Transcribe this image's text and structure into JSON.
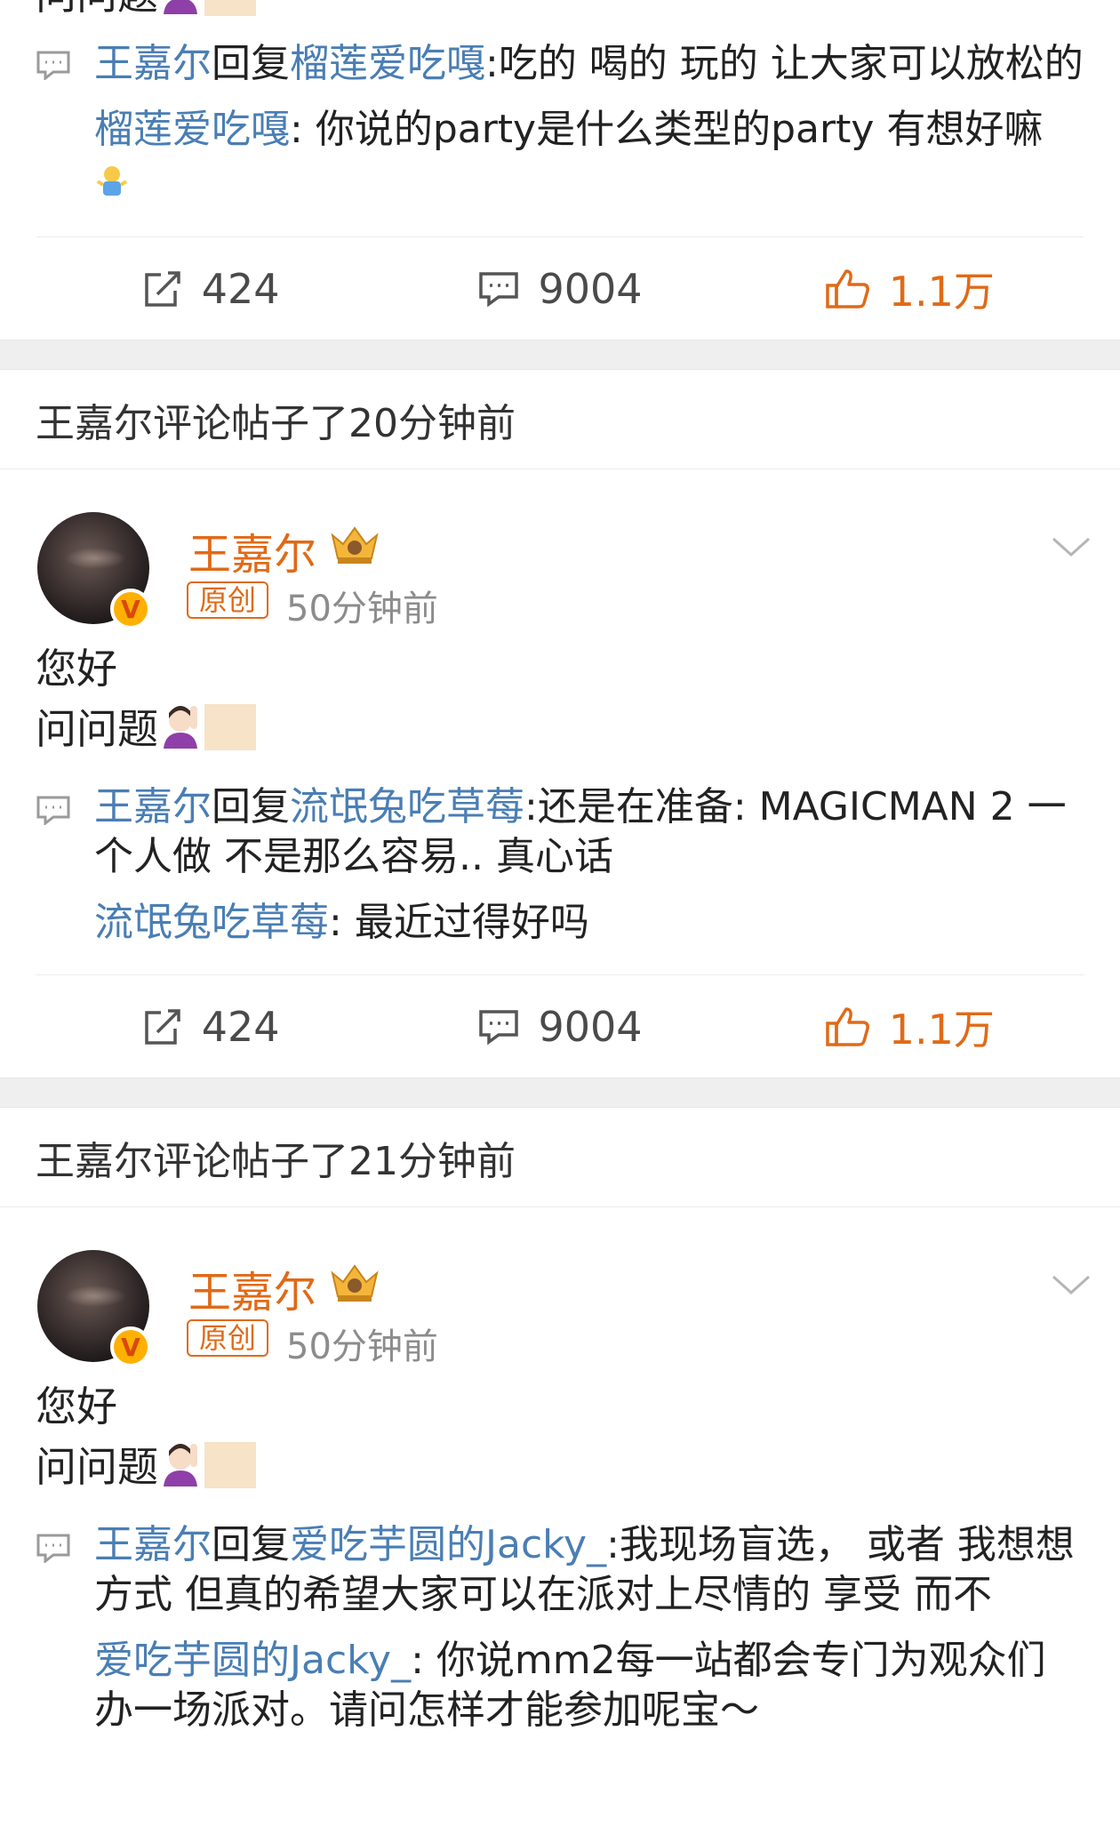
{
  "top_card": {
    "cut_text": "问问题",
    "reply": {
      "author": "王嘉尔",
      "verb": "回复",
      "target": "榴莲爱吃嘎",
      "text": ":吃的 喝的 玩的 让大家可以放松的"
    },
    "quote": {
      "author": "榴莲爱吃嘎",
      "sep": ":",
      "text": " 你说的party是什么类型的party 有想好嘛"
    },
    "actions": {
      "share": "424",
      "comment": "9004",
      "like": "1.1万"
    }
  },
  "posts": [
    {
      "header": "王嘉尔评论帖子了20分钟前",
      "author_name": "王嘉尔",
      "verified": "V",
      "original_badge": "原创",
      "time": "50分钟前",
      "line1": "您好",
      "line2": "问问题",
      "reply": {
        "author": "王嘉尔",
        "verb": "回复",
        "target": "流氓兔吃草莓",
        "text": ":还是在准备: MAGICMAN 2 一个人做 不是那么容易.. 真心话"
      },
      "quote": {
        "author": "流氓兔吃草莓",
        "sep": ":",
        "text": " 最近过得好吗"
      },
      "actions": {
        "share": "424",
        "comment": "9004",
        "like": "1.1万"
      }
    },
    {
      "header": "王嘉尔评论帖子了21分钟前",
      "author_name": "王嘉尔",
      "verified": "V",
      "original_badge": "原创",
      "time": "50分钟前",
      "line1": "您好",
      "line2": "问问题",
      "reply": {
        "author": "王嘉尔",
        "verb": "回复",
        "target": "爱吃芋圆的Jacky_",
        "text": ":我现场盲选， 或者 我想想方式 但真的希望大家可以在派对上尽情的 享受 而不"
      },
      "quote": {
        "author": "爱吃芋圆的Jacky_",
        "sep": ":",
        "text": " 你说mm2每一站都会专门为观众们办一场派对。请问怎样才能参加呢宝～"
      }
    }
  ],
  "colors": {
    "link": "#4a7eb4",
    "accent": "#e06a17"
  }
}
